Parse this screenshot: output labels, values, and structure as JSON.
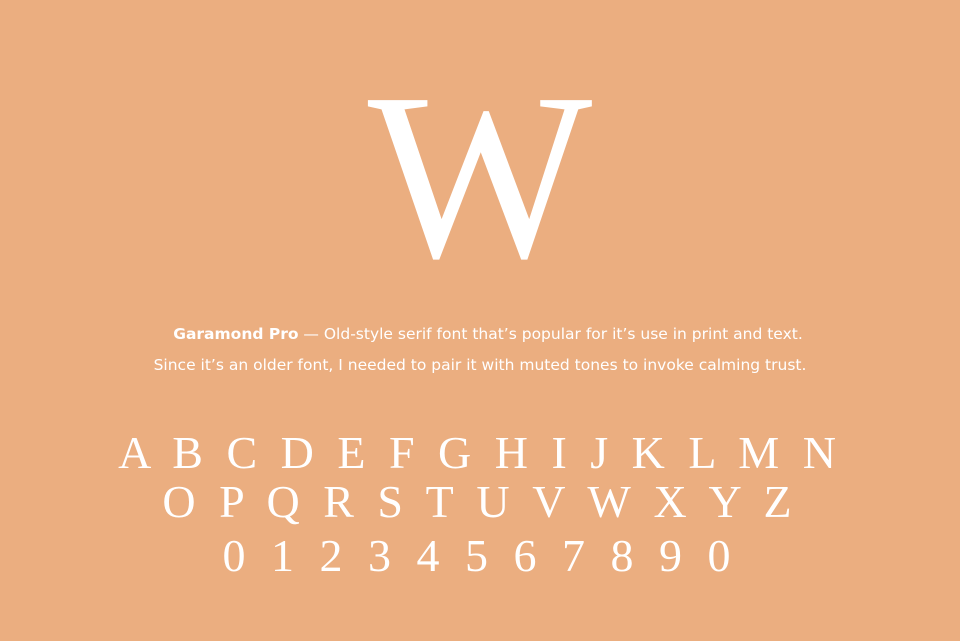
{
  "specimen": {
    "display_letter": "W",
    "font_name": "Garamond Pro",
    "description_line1_rest": " — Old-style serif font that’s popular for it’s use in print and text.",
    "description_line2": "Since it’s an older font, I needed to pair it with muted tones to invoke calming trust.",
    "alphabet_row1": "A B C D E F G H I J K L M N",
    "alphabet_row2": "O P Q R S T U V W X Y Z",
    "digits_row": "0 1 2 3 4 5 6 7 8 9 0"
  },
  "colors": {
    "background": "#ebae80",
    "text": "#ffffff"
  }
}
